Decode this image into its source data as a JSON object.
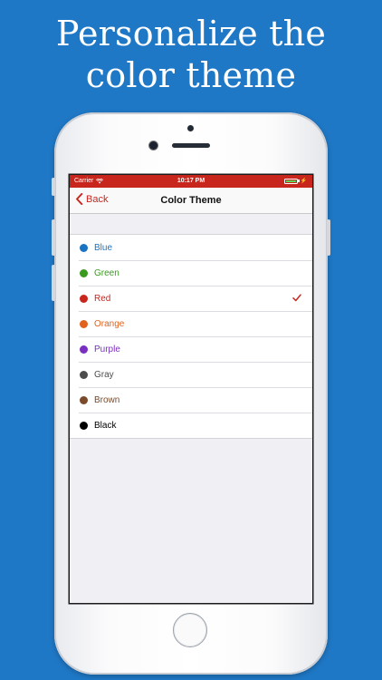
{
  "headline": {
    "line1": "Personalize the",
    "line2": "color theme"
  },
  "status_bar": {
    "carrier": "Carrier",
    "time": "10:17 PM",
    "background": "#c8251c"
  },
  "nav": {
    "back_label": "Back",
    "title": "Color Theme"
  },
  "accent_color": "#c8251c",
  "themes": [
    {
      "label": "Blue",
      "color": "#1a73c2",
      "selected": false
    },
    {
      "label": "Green",
      "color": "#3a9a1f",
      "selected": false
    },
    {
      "label": "Red",
      "color": "#c8251c",
      "selected": true
    },
    {
      "label": "Orange",
      "color": "#e0621d",
      "selected": false
    },
    {
      "label": "Purple",
      "color": "#7a2fc2",
      "selected": false
    },
    {
      "label": "Gray",
      "color": "#4d4d4d",
      "selected": false
    },
    {
      "label": "Brown",
      "color": "#7a4a2a",
      "selected": false
    },
    {
      "label": "Black",
      "color": "#000000",
      "selected": false
    }
  ]
}
